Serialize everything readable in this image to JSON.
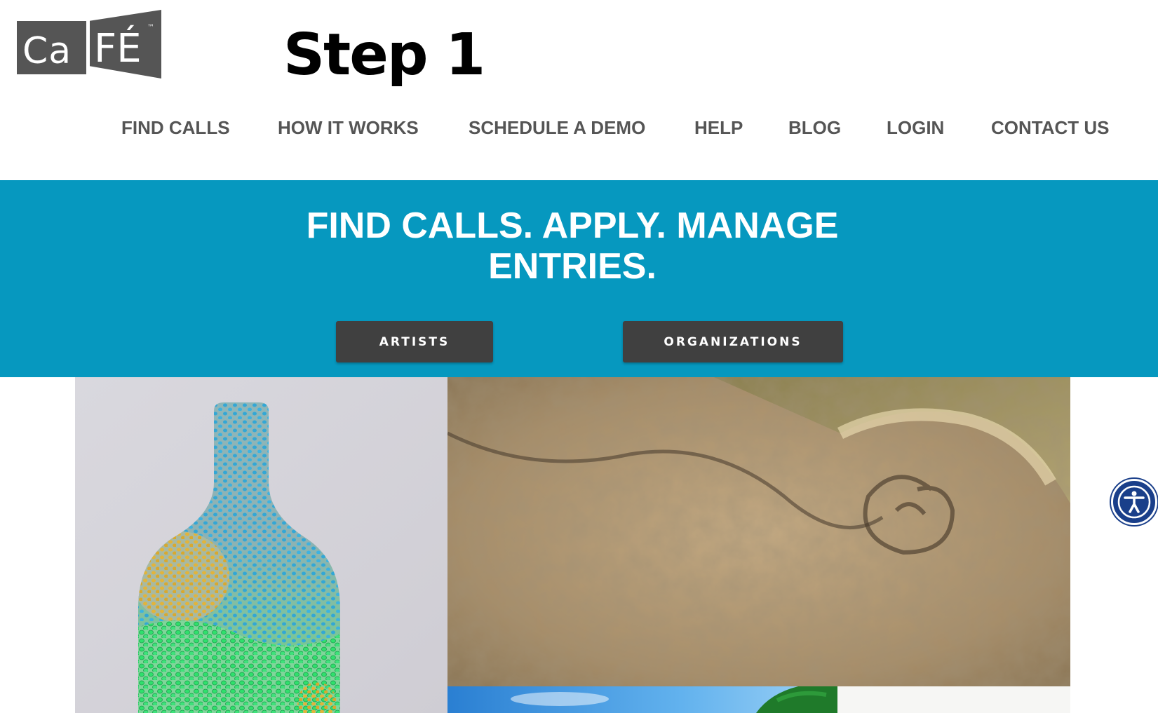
{
  "brand": {
    "logo_text": "CaFÉ",
    "trademark": "™"
  },
  "step_label": "Step 1",
  "nav": {
    "items": [
      {
        "label": "FIND CALLS"
      },
      {
        "label": "HOW IT WORKS"
      },
      {
        "label": "SCHEDULE A DEMO"
      },
      {
        "label": "HELP"
      },
      {
        "label": "BLOG"
      },
      {
        "label": "LOGIN"
      },
      {
        "label": "CONTACT US"
      }
    ]
  },
  "hero": {
    "headline_line1": "FIND CALLS. APPLY. MANAGE",
    "headline_line2": "ENTRIES.",
    "buttons": {
      "artists": "ARTISTS",
      "organizations": "ORGANIZATIONS"
    }
  },
  "gallery": {
    "images": [
      {
        "subject": "dotted glass bottle artwork"
      },
      {
        "subject": "felted wool swirl texture artwork"
      },
      {
        "subject": "sky with palm tree artwork"
      }
    ]
  },
  "accessibility": {
    "icon": "accessibility-icon"
  },
  "colors": {
    "hero_bg": "#0698bf",
    "button_bg": "#404040",
    "nav_text": "#555555",
    "logo_gray": "#555555",
    "accessibility_blue": "#1a3f8a"
  }
}
